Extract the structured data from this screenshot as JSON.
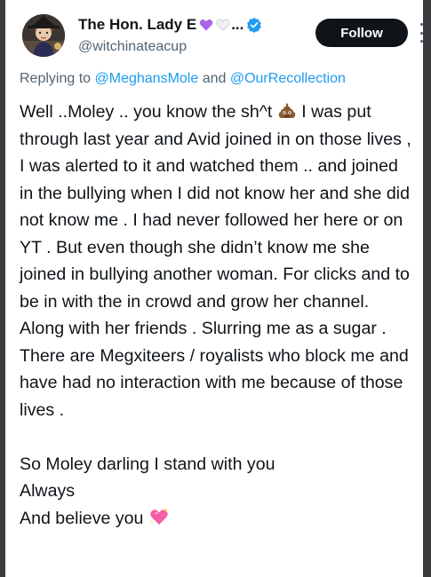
{
  "author": {
    "display_name": "The Hon. Lady E",
    "name_ellipsis": "...",
    "handle": "@witchinateacup",
    "verified": true,
    "heart_colors": [
      "#a965e8",
      "#e4e6ea"
    ]
  },
  "actions": {
    "follow_label": "Follow",
    "more_icon": "more-vertical-icon"
  },
  "reply_context": {
    "prefix": "Replying to ",
    "mention_1": "@MeghansMole",
    "joiner": " and ",
    "mention_2": "@OurRecollection"
  },
  "tweet": {
    "p1_a": "Well ..Moley .. you know the sh^t ",
    "p1_emoji": "pile-of-poo-icon",
    "p1_b": " I was put through last year and Avid joined in on those lives , I was alerted to it and watched them .. and joined in the bullying when I did not know her and she did not know me . I had never followed her here or on YT . But even though she didn’t know me she joined in bullying another woman. For clicks and to be in with the in crowd and grow her channel.",
    "p2": "Along with her friends . Slurring me as a sugar . There are Megxiteers / royalists who block me and have had no interaction with me because of those lives .",
    "p3": "So Moley darling I stand with you",
    "p4": "Always",
    "p5_a": "And believe you ",
    "p5_emoji": "sparkling-heart-icon"
  },
  "colors": {
    "accent": "#1d9bf0",
    "text": "#0f1419",
    "secondary_text": "#536471",
    "follow_bg": "#0f1419"
  }
}
